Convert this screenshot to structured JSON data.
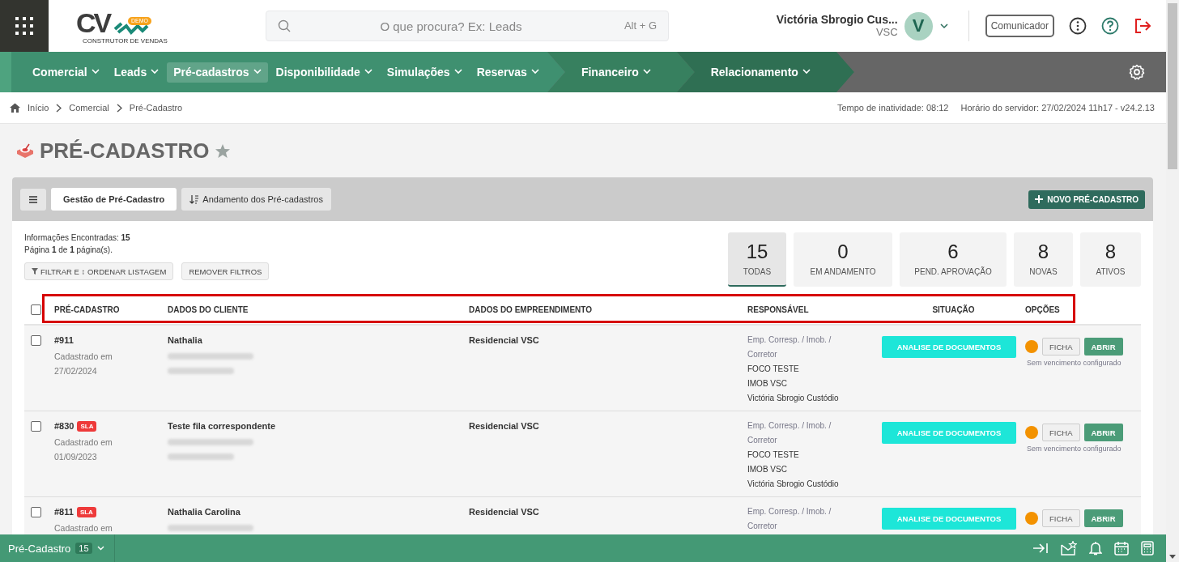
{
  "header": {
    "logo": {
      "letters": "CV",
      "badge": "DEMO",
      "tagline": "CONSTRUTOR DE VENDAS"
    },
    "search": {
      "placeholder": "O que procura? Ex: Leads",
      "shortcut": "Alt + G"
    },
    "user": {
      "name": "Victória Sbrogio Cus...",
      "company": "VSC",
      "initial": "V"
    },
    "communicator_button": "Comunicador"
  },
  "nav": {
    "groups": [
      {
        "items": [
          {
            "label": "Comercial",
            "selected": false
          },
          {
            "label": "Leads",
            "selected": false
          },
          {
            "label": "Pré-cadastros",
            "selected": true
          },
          {
            "label": "Disponibilidade",
            "selected": false
          },
          {
            "label": "Simulações",
            "selected": false
          },
          {
            "label": "Reservas",
            "selected": false
          }
        ]
      },
      {
        "items": [
          {
            "label": "Financeiro",
            "selected": false
          }
        ]
      },
      {
        "items": [
          {
            "label": "Relacionamento",
            "selected": false
          }
        ]
      }
    ]
  },
  "breadcrumb": {
    "items": [
      "Início",
      "Comercial",
      "Pré-Cadastro"
    ],
    "status": [
      "Tempo de inatividade: 08:12",
      "Horário do servidor: 27/02/2024 11h17 - v24.2.13"
    ]
  },
  "page_title": "PRÉ-CADASTRO",
  "favorite": false,
  "tabs": [
    {
      "label": "Gestão de Pré-Cadastro",
      "selected": true
    },
    {
      "label": "Andamento dos Pré-cadastros",
      "selected": false
    }
  ],
  "new_button": "NOVO PRÉ-CADASTRO",
  "summary": {
    "found": "Informações Encontradas: **15**",
    "pages": "Página **1** de **1** página(s)."
  },
  "filter_buttons": [
    "FILTRAR E ↕ ORDENAR LISTAGEM",
    "REMOVER FILTROS"
  ],
  "stats": [
    {
      "value": "15",
      "label": "TODAS",
      "selected": true
    },
    {
      "value": "0",
      "label": "EM ANDAMENTO",
      "selected": false
    },
    {
      "value": "6",
      "label": "PEND. APROVAÇÃO",
      "selected": false
    },
    {
      "value": "8",
      "label": "NOVAS",
      "selected": false
    },
    {
      "value": "8",
      "label": "ATIVOS",
      "selected": false
    }
  ],
  "table": {
    "highlighted_header": true,
    "select_all_checked": false,
    "columns": [
      "PRÉ-CADASTRO",
      "DADOS DO CLIENTE",
      "DADOS DO EMPREENDIMENTO",
      "RESPONSÁVEL",
      "SITUAÇÃO",
      "OPÇÕES"
    ],
    "rows": [
      {
        "id": "#911",
        "checked": false,
        "registered": "Cadastrado em",
        "date": "27/02/2024",
        "client": "Nathalia",
        "project": "Residencial VSC",
        "responsible_role": "Emp. Corresp. / Imob. / Corretor",
        "responsible": [
          "FOCO TESTE",
          "IMOB VSC",
          "Victória Sbrogio Custódio"
        ],
        "status": "ANALISE DE DOCUMENTOS",
        "color": "#f39200",
        "actions": [
          "FICHA",
          "ABRIR"
        ],
        "deadline": "Sem vencimento configurado"
      },
      {
        "id": "#830",
        "checked": false,
        "badge": "SLA",
        "registered": "Cadastrado em",
        "date": "01/09/2023",
        "client": "Teste fila correspondente",
        "project": "Residencial VSC",
        "responsible_role": "Emp. Corresp. / Imob. / Corretor",
        "responsible": [
          "FOCO TESTE",
          "IMOB VSC",
          "Victória Sbrogio Custódio"
        ],
        "status": "ANALISE DE DOCUMENTOS",
        "color": "#f39200",
        "actions": [
          "FICHA",
          "ABRIR"
        ],
        "deadline": "Sem vencimento configurado"
      },
      {
        "id": "#811",
        "checked": false,
        "badge": "SLA",
        "registered": "Cadastrado em",
        "client": "Nathalia Carolina",
        "project": "Residencial VSC",
        "responsible_role": "Emp. Corresp. / Imob. / Corretor",
        "status": "ANALISE DE DOCUMENTOS",
        "color": "#f39200",
        "actions": [
          "FICHA",
          "ABRIR"
        ]
      }
    ]
  },
  "bottom_bar": {
    "label": "Pré-Cadastro",
    "count": "15"
  }
}
